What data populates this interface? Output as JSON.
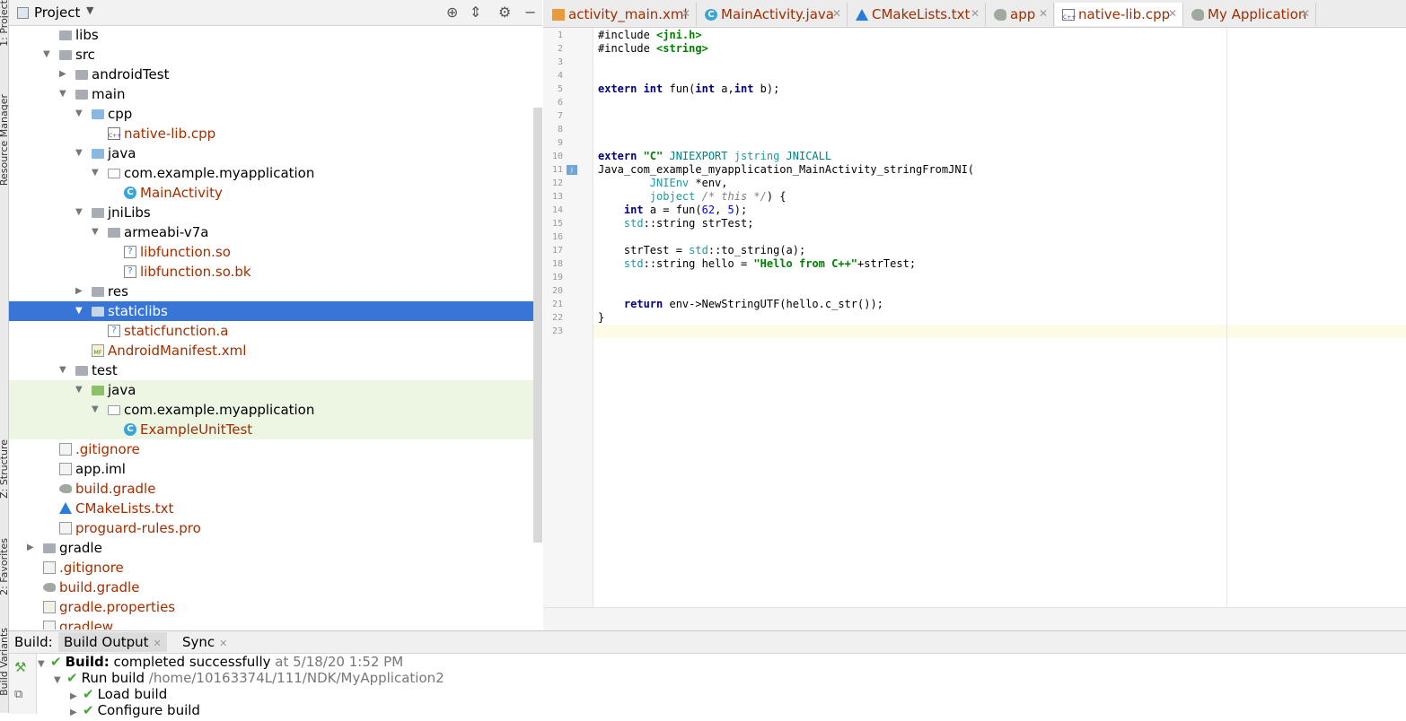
{
  "left_strip": {
    "tabs": [
      "1: Project",
      "Resource Manager",
      "Z: Structure",
      "2: Favorites",
      "Build Variants"
    ]
  },
  "project_panel": {
    "title": "Project",
    "header_icons": [
      "locate-icon",
      "collapse-icon",
      "gear-icon",
      "hide-icon"
    ],
    "tree": [
      {
        "label": "libs",
        "indent": 0,
        "arrow": "",
        "icon": "folder",
        "color": "black"
      },
      {
        "label": "src",
        "indent": 0,
        "arrow": "down",
        "icon": "folder",
        "color": "black"
      },
      {
        "label": "androidTest",
        "indent": 1,
        "arrow": "right",
        "icon": "folder",
        "color": "black"
      },
      {
        "label": "main",
        "indent": 1,
        "arrow": "down",
        "icon": "folder",
        "color": "black"
      },
      {
        "label": "cpp",
        "indent": 2,
        "arrow": "down",
        "icon": "folder-blue",
        "color": "black"
      },
      {
        "label": "native-lib.cpp",
        "indent": 3,
        "arrow": "",
        "icon": "cpp",
        "color": "red"
      },
      {
        "label": "java",
        "indent": 2,
        "arrow": "down",
        "icon": "folder-blue",
        "color": "black"
      },
      {
        "label": "com.example.myapplication",
        "indent": 3,
        "arrow": "down",
        "icon": "package",
        "color": "black"
      },
      {
        "label": "MainActivity",
        "indent": 4,
        "arrow": "",
        "icon": "class",
        "color": "red"
      },
      {
        "label": "jniLibs",
        "indent": 2,
        "arrow": "down",
        "icon": "folder",
        "color": "black"
      },
      {
        "label": "armeabi-v7a",
        "indent": 3,
        "arrow": "down",
        "icon": "folder",
        "color": "black"
      },
      {
        "label": "libfunction.so",
        "indent": 4,
        "arrow": "",
        "icon": "unknown",
        "color": "red"
      },
      {
        "label": "libfunction.so.bk",
        "indent": 4,
        "arrow": "",
        "icon": "unknown",
        "color": "red"
      },
      {
        "label": "res",
        "indent": 2,
        "arrow": "right",
        "icon": "folder",
        "color": "black"
      },
      {
        "label": "staticlibs",
        "indent": 2,
        "arrow": "down",
        "icon": "folder-white",
        "color": "black",
        "selected": true
      },
      {
        "label": "staticfunction.a",
        "indent": 3,
        "arrow": "",
        "icon": "unknown",
        "color": "red"
      },
      {
        "label": "AndroidManifest.xml",
        "indent": 2,
        "arrow": "",
        "icon": "manifest",
        "color": "red"
      },
      {
        "label": "test",
        "indent": 1,
        "arrow": "down",
        "icon": "folder",
        "color": "black"
      },
      {
        "label": "java",
        "indent": 2,
        "arrow": "down",
        "icon": "folder-green",
        "color": "black",
        "green": true
      },
      {
        "label": "com.example.myapplication",
        "indent": 3,
        "arrow": "down",
        "icon": "package",
        "color": "black",
        "green": true
      },
      {
        "label": "ExampleUnitTest",
        "indent": 4,
        "arrow": "",
        "icon": "class-test",
        "color": "red",
        "green": true
      },
      {
        "label": ".gitignore",
        "indent": 0,
        "arrow": "",
        "icon": "file",
        "color": "red"
      },
      {
        "label": "app.iml",
        "indent": 0,
        "arrow": "",
        "icon": "iml",
        "color": "black"
      },
      {
        "label": "build.gradle",
        "indent": 0,
        "arrow": "",
        "icon": "gradle",
        "color": "red"
      },
      {
        "label": "CMakeLists.txt",
        "indent": 0,
        "arrow": "",
        "icon": "cmake",
        "color": "red"
      },
      {
        "label": "proguard-rules.pro",
        "indent": 0,
        "arrow": "",
        "icon": "file",
        "color": "red"
      },
      {
        "label": "gradle",
        "indent": -1,
        "arrow": "right",
        "icon": "folder",
        "color": "black"
      },
      {
        "label": ".gitignore",
        "indent": -1,
        "arrow": "",
        "icon": "file",
        "color": "red"
      },
      {
        "label": "build.gradle",
        "indent": -1,
        "arrow": "",
        "icon": "gradle",
        "color": "red"
      },
      {
        "label": "gradle.properties",
        "indent": -1,
        "arrow": "",
        "icon": "properties",
        "color": "red"
      },
      {
        "label": "gradlew",
        "indent": -1,
        "arrow": "",
        "icon": "file",
        "color": "red"
      }
    ]
  },
  "editor": {
    "tabs": [
      {
        "label": "activity_main.xml",
        "icon": "xml-icon",
        "active": false
      },
      {
        "label": "MainActivity.java",
        "icon": "class-icon",
        "active": false
      },
      {
        "label": "CMakeLists.txt",
        "icon": "cmake-icon",
        "active": false
      },
      {
        "label": "app",
        "icon": "gradle-icon",
        "active": false
      },
      {
        "label": "native-lib.cpp",
        "icon": "cpp-icon",
        "active": true
      },
      {
        "label": "My Application",
        "icon": "gradle-icon",
        "active": false
      }
    ],
    "line_numbers": [
      "1",
      "2",
      "3",
      "4",
      "5",
      "6",
      "7",
      "8",
      "9",
      "10",
      "11",
      "12",
      "13",
      "14",
      "15",
      "16",
      "17",
      "18",
      "19",
      "20",
      "21",
      "22",
      "23"
    ],
    "code_lines": [
      [
        [
          "pp",
          "#include "
        ],
        [
          "str",
          "<jni.h>"
        ]
      ],
      [
        [
          "pp",
          "#include "
        ],
        [
          "str",
          "<string>"
        ]
      ],
      [],
      [],
      [
        [
          "kw",
          "extern "
        ],
        [
          "kw",
          "int "
        ],
        [
          "p",
          "fun("
        ],
        [
          "kw",
          "int "
        ],
        [
          "p",
          "a,"
        ],
        [
          "kw",
          "int "
        ],
        [
          "p",
          "b);"
        ]
      ],
      [],
      [],
      [],
      [],
      [
        [
          "kw",
          "extern "
        ],
        [
          "str",
          "\"C\" "
        ],
        [
          "mac",
          "JNIEXPORT "
        ],
        [
          "typ",
          "jstring "
        ],
        [
          "mac",
          "JNICALL"
        ]
      ],
      [
        [
          "p",
          "Java_com_example_myapplication_MainActivity_stringFromJNI("
        ]
      ],
      [
        [
          "p",
          "        "
        ],
        [
          "typ",
          "JNIEnv "
        ],
        [
          "p",
          "*env,"
        ]
      ],
      [
        [
          "p",
          "        "
        ],
        [
          "typ",
          "jobject "
        ],
        [
          "cmt",
          "/* this */"
        ],
        [
          "p",
          ") {"
        ]
      ],
      [
        [
          "p",
          "    "
        ],
        [
          "kw",
          "int "
        ],
        [
          "p",
          "a = fun("
        ],
        [
          "num",
          "62"
        ],
        [
          "p",
          ", "
        ],
        [
          "num",
          "5"
        ],
        [
          "p",
          ");"
        ]
      ],
      [
        [
          "p",
          "    "
        ],
        [
          "typ",
          "std"
        ],
        [
          "p",
          "::string strTest;"
        ]
      ],
      [],
      [
        [
          "p",
          "    strTest = "
        ],
        [
          "typ",
          "std"
        ],
        [
          "p",
          "::to_string(a);"
        ]
      ],
      [
        [
          "p",
          "    "
        ],
        [
          "typ",
          "std"
        ],
        [
          "p",
          "::string hello = "
        ],
        [
          "str",
          "\"Hello from C++\""
        ],
        [
          "p",
          "+strTest;"
        ]
      ],
      [],
      [],
      [
        [
          "p",
          "    "
        ],
        [
          "kw",
          "return "
        ],
        [
          "p",
          "env->NewStringUTF(hello.c_str());"
        ]
      ],
      [
        [
          "p",
          "}"
        ]
      ],
      []
    ]
  },
  "build": {
    "label": "Build:",
    "tabs": [
      {
        "label": "Build Output",
        "active": true
      },
      {
        "label": "Sync",
        "active": false
      }
    ],
    "rows": [
      {
        "bold": "Build:",
        "text": " completed successfully",
        "gray": " at 5/18/20 1:52 PM",
        "arrow": "down",
        "indent": 0
      },
      {
        "bold": "",
        "text": "Run build",
        "gray": " /home/10163374L/111/NDK/MyApplication2",
        "arrow": "down",
        "indent": 1
      },
      {
        "bold": "",
        "text": "Load build",
        "gray": "",
        "arrow": "right",
        "indent": 2
      },
      {
        "bold": "",
        "text": "Configure build",
        "gray": "",
        "arrow": "right",
        "indent": 2
      }
    ]
  },
  "colors": {
    "selection": "#3875d7",
    "modified_file": "#a32e00",
    "keyword": "#000080",
    "string": "#008000"
  }
}
